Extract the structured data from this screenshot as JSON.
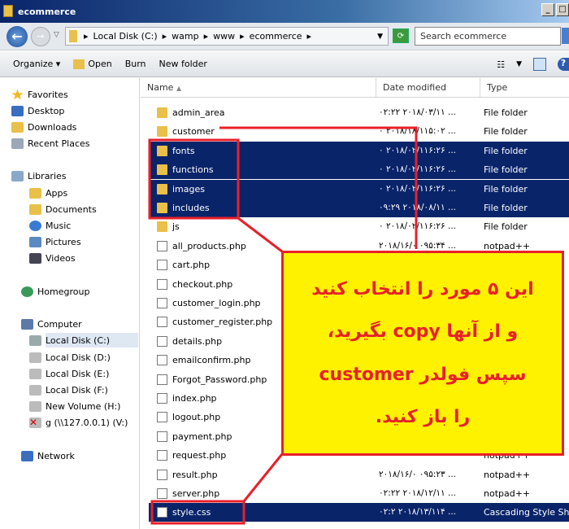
{
  "window": {
    "title": "ecommerce",
    "controls": [
      "_",
      "□"
    ]
  },
  "address": {
    "crumbs": [
      "Local Disk (C:)",
      "wamp",
      "www",
      "ecommerce"
    ],
    "search_placeholder": "Search ecommerce"
  },
  "toolbar": {
    "organize": "Organize ▾",
    "open": "Open",
    "burn": "Burn",
    "new_folder": "New folder"
  },
  "nav": {
    "favorites": "Favorites",
    "desktop": "Desktop",
    "downloads": "Downloads",
    "recent": "Recent Places",
    "libraries": "Libraries",
    "apps": "Apps",
    "documents": "Documents",
    "music": "Music",
    "pictures": "Pictures",
    "videos": "Videos",
    "homegroup": "Homegroup",
    "computer": "Computer",
    "c": "Local Disk (C:)",
    "d": "Local Disk (D:)",
    "e": "Local Disk (E:)",
    "f": "Local Disk (F:)",
    "h": "New Volume (H:)",
    "v": "g (\\\\127.0.0.1) (V:)",
    "network": "Network"
  },
  "columns": {
    "name": "Name",
    "date": "Date modified",
    "type": "Type"
  },
  "files": [
    {
      "name": "admin_area",
      "date": "٢٠١٨/٠٣/١١ ٠٢:٢٢ ...",
      "type": "File folder",
      "kind": "folder",
      "selected": false
    },
    {
      "name": "customer",
      "date": "٢٠١٨/١٨/١١ ٠۵:٠٢ ...",
      "type": "File folder",
      "kind": "folder",
      "selected": false
    },
    {
      "name": "fonts",
      "date": "٢٠١٨/٠٢/١١ ٠۶:٢۶ ...",
      "type": "File folder",
      "kind": "folder",
      "selected": true
    },
    {
      "name": "functions",
      "date": "٢٠١٨/٠٢/١١ ٠۶:٢۶ ...",
      "type": "File folder",
      "kind": "folder",
      "selected": true
    },
    {
      "name": "images",
      "date": "٢٠١٨/٠٢/١١ ٠۶:٢۶ ...",
      "type": "File folder",
      "kind": "folder",
      "selected": true
    },
    {
      "name": "includes",
      "date": "٢٠١٨/٠٨/١١ ٠٩:٢٩ ...",
      "type": "File folder",
      "kind": "folder",
      "selected": true
    },
    {
      "name": "js",
      "date": "٢٠١٨/٠٢/١١ ٠۶:٢۶ ...",
      "type": "File folder",
      "kind": "folder",
      "selected": false
    },
    {
      "name": "all_products.php",
      "date": "٢٠١٨/١۶/٠٩ ٠۵:٣۴ ...",
      "type": "notpad++",
      "kind": "doc",
      "selected": false
    },
    {
      "name": "cart.php",
      "date": "",
      "type": "",
      "kind": "doc",
      "selected": false
    },
    {
      "name": "checkout.php",
      "date": "",
      "type": "",
      "kind": "doc",
      "selected": false
    },
    {
      "name": "customer_login.php",
      "date": "",
      "type": "",
      "kind": "doc",
      "selected": false
    },
    {
      "name": "customer_register.php",
      "date": "",
      "type": "",
      "kind": "doc",
      "selected": false
    },
    {
      "name": "details.php",
      "date": "",
      "type": "",
      "kind": "doc",
      "selected": false
    },
    {
      "name": "emailconfirm.php",
      "date": "",
      "type": "",
      "kind": "doc",
      "selected": false
    },
    {
      "name": "Forgot_Password.php",
      "date": "",
      "type": "",
      "kind": "doc",
      "selected": false
    },
    {
      "name": "index.php",
      "date": "",
      "type": "",
      "kind": "doc",
      "selected": false
    },
    {
      "name": "logout.php",
      "date": "",
      "type": "",
      "kind": "doc",
      "selected": false
    },
    {
      "name": "payment.php",
      "date": "",
      "type": "",
      "kind": "doc",
      "selected": false
    },
    {
      "name": "request.php",
      "date": "",
      "type": "notpad++",
      "kind": "doc",
      "selected": false
    },
    {
      "name": "result.php",
      "date": "٢٠١٨/١۶/٠٩ ٠۵:٢٣ ...",
      "type": "notpad++",
      "kind": "doc",
      "selected": false
    },
    {
      "name": "server.php",
      "date": "٢٠١٨/١٢/١١ ٠٢:٢٢ ...",
      "type": "notpad++",
      "kind": "doc",
      "selected": false
    },
    {
      "name": "style.css",
      "date": "٢٠١٨/١٣/١١ ٠٢:٢۴ ...",
      "type": "Cascading Style Sh...",
      "kind": "doc",
      "selected": true
    }
  ],
  "callout": {
    "lines": [
      "این ۵ مورد را انتخاب کنید",
      "و از آنها copy بگیرید،",
      "سپس  فولدر customer",
      "را باز کنید."
    ]
  },
  "colors": {
    "selection": "#0a246a",
    "callout_bg": "#fff200",
    "callout_border": "#e8202a"
  }
}
